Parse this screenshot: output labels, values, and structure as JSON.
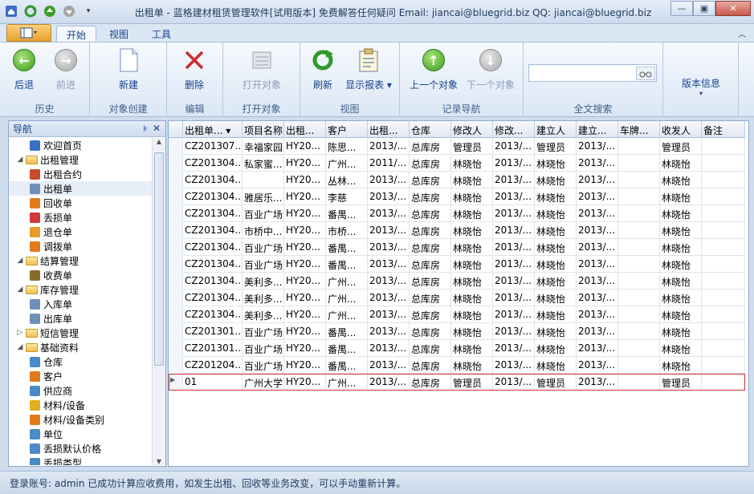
{
  "window": {
    "title": "出租单 - 蓝格建材租赁管理软件[试用版本] 免费解答任何疑问 Email: jiancai@bluegrid.biz QQ: jiancai@bluegrid.biz"
  },
  "tabs": [
    "开始",
    "视图",
    "工具"
  ],
  "ribbon": {
    "groups": {
      "history": "历史",
      "create": "对象创建",
      "edit": "编辑",
      "open": "打开对象",
      "view": "视图",
      "nav": "记录导航",
      "search": "全文搜索"
    },
    "buttons": {
      "back": "后退",
      "forward": "前进",
      "new": "新建",
      "delete": "删除",
      "open_object": "打开对象",
      "refresh": "刷新",
      "show_report": "显示报表",
      "prev": "上一个对象",
      "next": "下一个对象",
      "version": "版本信息"
    },
    "search_value": ""
  },
  "nav": {
    "title": "导航",
    "items": [
      {
        "label": "欢迎首页",
        "level": 1,
        "icon": "home-icon"
      },
      {
        "label": "出租管理",
        "level": 0,
        "icon": "folder-icon",
        "exp": "◢"
      },
      {
        "label": "出租合约",
        "level": 1,
        "icon": "contract-icon"
      },
      {
        "label": "出租单",
        "level": 1,
        "icon": "document-icon"
      },
      {
        "label": "回收单",
        "level": 1,
        "icon": "recycle-icon"
      },
      {
        "label": "丢损单",
        "level": 1,
        "icon": "damage-icon"
      },
      {
        "label": "退仓单",
        "level": 1,
        "icon": "return-icon"
      },
      {
        "label": "调拨单",
        "level": 1,
        "icon": "transfer-icon"
      },
      {
        "label": "结算管理",
        "level": 0,
        "icon": "folder-icon",
        "exp": "◢"
      },
      {
        "label": "收费单",
        "level": 1,
        "icon": "money-bag-icon"
      },
      {
        "label": "库存管理",
        "level": 0,
        "icon": "folder-icon",
        "exp": "◢"
      },
      {
        "label": "入库单",
        "level": 1,
        "icon": "document-icon"
      },
      {
        "label": "出库单",
        "level": 1,
        "icon": "document-icon"
      },
      {
        "label": "短信管理",
        "level": 0,
        "icon": "folder-icon",
        "exp": "▷"
      },
      {
        "label": "基础资料",
        "level": 0,
        "icon": "folder-icon",
        "exp": "◢"
      },
      {
        "label": "仓库",
        "level": 1,
        "icon": "warehouse-icon"
      },
      {
        "label": "客户",
        "level": 1,
        "icon": "customer-icon"
      },
      {
        "label": "供应商",
        "level": 1,
        "icon": "supplier-icon"
      },
      {
        "label": "材料/设备",
        "level": 1,
        "icon": "material-icon"
      },
      {
        "label": "材料/设备类别",
        "level": 1,
        "icon": "category-icon"
      },
      {
        "label": "单位",
        "level": 1,
        "icon": "unit-icon"
      },
      {
        "label": "丢损默认价格",
        "level": 1,
        "icon": "price-icon"
      },
      {
        "label": "丢损类型",
        "level": 1,
        "icon": "type-icon"
      }
    ]
  },
  "grid": {
    "columns": [
      "出租单...",
      "项目名称",
      "出租...",
      "客户",
      "出租...",
      "仓库",
      "修改人",
      "修改...",
      "建立人",
      "建立...",
      "车牌...",
      "收发人",
      "备注"
    ],
    "rows": [
      [
        "CZ201307...",
        "幸福家园",
        "HY20...",
        "陈思...",
        "2013/...",
        "总库房",
        "管理员",
        "2013/...",
        "管理员",
        "2013/...",
        "",
        "管理员",
        ""
      ],
      [
        "CZ201304...",
        "私家蜜...",
        "HY20...",
        "广州...",
        "2011/...",
        "总库房",
        "林晓怡",
        "2013/...",
        "林晓怡",
        "2013/...",
        "",
        "林晓怡",
        ""
      ],
      [
        "CZ201304...",
        "",
        "HY20...",
        "丛林...",
        "2013/...",
        "总库房",
        "林晓怡",
        "2013/...",
        "林晓怡",
        "2013/...",
        "",
        "林晓怡",
        ""
      ],
      [
        "CZ201304...",
        "雅居乐...",
        "HY20...",
        "李慈",
        "2013/...",
        "总库房",
        "林晓怡",
        "2013/...",
        "林晓怡",
        "2013/...",
        "",
        "林晓怡",
        ""
      ],
      [
        "CZ201304...",
        "百业广场",
        "HY20...",
        "番禺...",
        "2013/...",
        "总库房",
        "林晓怡",
        "2013/...",
        "林晓怡",
        "2013/...",
        "",
        "林晓怡",
        ""
      ],
      [
        "CZ201304...",
        "市桥中...",
        "HY20...",
        "市桥...",
        "2013/...",
        "总库房",
        "林晓怡",
        "2013/...",
        "林晓怡",
        "2013/...",
        "",
        "林晓怡",
        ""
      ],
      [
        "CZ201304...",
        "百业广场",
        "HY20...",
        "番禺...",
        "2013/...",
        "总库房",
        "林晓怡",
        "2013/...",
        "林晓怡",
        "2013/...",
        "",
        "林晓怡",
        ""
      ],
      [
        "CZ201304...",
        "百业广场",
        "HY20...",
        "番禺...",
        "2013/...",
        "总库房",
        "林晓怡",
        "2013/...",
        "林晓怡",
        "2013/...",
        "",
        "林晓怡",
        ""
      ],
      [
        "CZ201304...",
        "美利多...",
        "HY20...",
        "广州...",
        "2013/...",
        "总库房",
        "林晓怡",
        "2013/...",
        "林晓怡",
        "2013/...",
        "",
        "林晓怡",
        ""
      ],
      [
        "CZ201304...",
        "美利多...",
        "HY20...",
        "广州...",
        "2013/...",
        "总库房",
        "林晓怡",
        "2013/...",
        "林晓怡",
        "2013/...",
        "",
        "林晓怡",
        ""
      ],
      [
        "CZ201304...",
        "美利多...",
        "HY20...",
        "广州...",
        "2013/...",
        "总库房",
        "林晓怡",
        "2013/...",
        "林晓怡",
        "2013/...",
        "",
        "林晓怡",
        ""
      ],
      [
        "CZ201301...",
        "百业广场",
        "HY20...",
        "番禺...",
        "2013/...",
        "总库房",
        "林晓怡",
        "2013/...",
        "林晓怡",
        "2013/...",
        "",
        "林晓怡",
        ""
      ],
      [
        "CZ201301...",
        "百业广场",
        "HY20...",
        "番禺...",
        "2013/...",
        "总库房",
        "林晓怡",
        "2013/...",
        "林晓怡",
        "2013/...",
        "",
        "林晓怡",
        ""
      ],
      [
        "CZ201204...",
        "百业广场",
        "HY20...",
        "番禺...",
        "2013/...",
        "总库房",
        "林晓怡",
        "2013/...",
        "林晓怡",
        "2013/...",
        "",
        "林晓怡",
        ""
      ],
      [
        "01",
        "广州大学",
        "HY20...",
        "广州...",
        "2013/...",
        "总库房",
        "管理员",
        "2013/...",
        "管理员",
        "2013/...",
        "",
        "管理员",
        ""
      ]
    ],
    "focused_row": 14
  },
  "status": {
    "text": "登录账号: admin   已成功计算应收费用，如发生出租、回收等业务改变，可以手动重新计算。"
  }
}
